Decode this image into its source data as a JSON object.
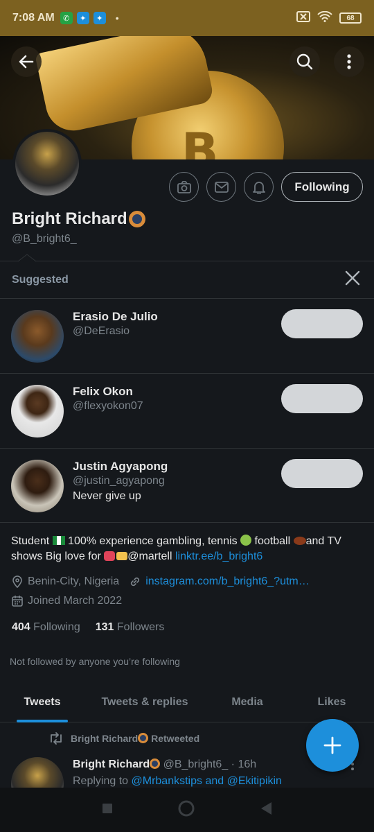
{
  "status_bar": {
    "time": "7:08 AM",
    "battery": "68"
  },
  "profile": {
    "name": "Bright Richard",
    "handle": "@B_bright6_",
    "following_button": "Following"
  },
  "suggested": {
    "title": "Suggested",
    "items": [
      {
        "name": "Erasio De Julio",
        "handle": "@DeErasio",
        "bio": ""
      },
      {
        "name": "Felix Okon",
        "handle": "@flexyokon07",
        "bio": ""
      },
      {
        "name": "Justin Agyapong",
        "handle": "@justin_agyapong",
        "bio": "Never give up"
      }
    ]
  },
  "bio": {
    "part1": "Student ",
    "part2": " 100% experience gambling, tennis ",
    "part3": " football ",
    "part4": "and TV shows Big love for ",
    "part5": "@martell ",
    "link": "linktr.ee/b_bright6",
    "location": "Benin-City, Nigeria",
    "website": "instagram.com/b_bright6_?utm…",
    "joined": "Joined March 2022"
  },
  "stats": {
    "following_count": "404",
    "following_label": "Following",
    "followers_count": "131",
    "followers_label": "Followers"
  },
  "not_followed": "Not followed by anyone you’re following",
  "tabs": [
    "Tweets",
    "Tweets & replies",
    "Media",
    "Likes"
  ],
  "tweet": {
    "retweet_label": "Bright Richard",
    "retweet_suffix": " Retweeted",
    "author": "Bright Richard",
    "handle": "@B_bright6_",
    "time": " · 16h",
    "reply_prefix": "Replying to ",
    "reply_to": "@Mrbankstips and @Ekitipikin"
  },
  "colors": {
    "accent": "#1d8fdb",
    "status_bar": "#7c6120",
    "background": "#15181c"
  }
}
